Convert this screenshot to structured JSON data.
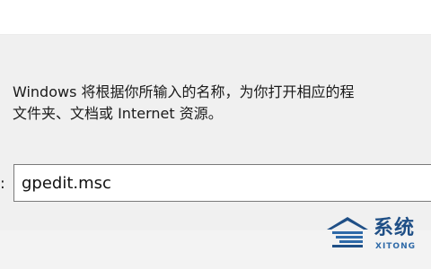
{
  "dialog": {
    "description_line1": "Windows 将根据你所输入的名称，为你打开相应的程",
    "description_line2": "文件夹、文档或 Internet 资源。",
    "open_label": ":",
    "open_value": "gpedit.msc"
  },
  "watermark": {
    "text_cn": "系统",
    "text_en": "XITONG"
  },
  "colors": {
    "body_background": "#f0f0f0",
    "input_border": "#7a7a7a",
    "watermark_blue": "#1f4f86"
  }
}
